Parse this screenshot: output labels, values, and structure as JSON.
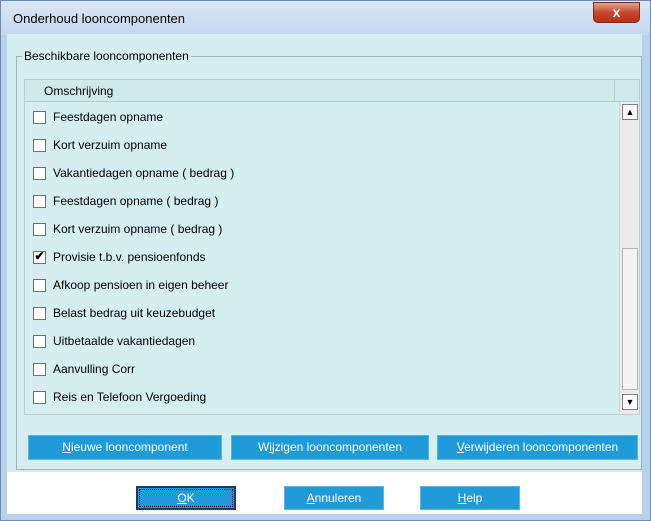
{
  "window": {
    "title": "Onderhoud looncomponenten",
    "close_glyph": "x"
  },
  "group": {
    "label": "Beschikbare looncomponenten"
  },
  "list": {
    "column_header": "Omschrijving",
    "rows": [
      {
        "label": "Feestdagen opname",
        "checked": false
      },
      {
        "label": "Kort verzuim opname",
        "checked": false
      },
      {
        "label": "Vakantiedagen opname ( bedrag )",
        "checked": false
      },
      {
        "label": "Feestdagen opname ( bedrag )",
        "checked": false
      },
      {
        "label": "Kort verzuim opname ( bedrag )",
        "checked": false
      },
      {
        "label": "Provisie t.b.v. pensioenfonds",
        "checked": true
      },
      {
        "label": "Afkoop pensioen in eigen beheer",
        "checked": false
      },
      {
        "label": "Belast bedrag uit keuzebudget",
        "checked": false
      },
      {
        "label": "Uitbetaalde vakantiedagen",
        "checked": false
      },
      {
        "label": "Aanvulling Corr",
        "checked": false
      },
      {
        "label": "Reis en Telefoon Vergoeding",
        "checked": false
      }
    ],
    "check_glyph": "✔",
    "scroll_up_glyph": "▲",
    "scroll_down_glyph": "▼"
  },
  "actions": {
    "new": {
      "mnemonic": "N",
      "rest": "ieuwe looncomponent"
    },
    "edit": {
      "prefix": "W",
      "mnemonic": "i",
      "rest": "jzigen looncomponenten"
    },
    "delete": {
      "mnemonic": "V",
      "rest": "erwijderen looncomponenten"
    }
  },
  "dialog": {
    "ok": {
      "mnemonic": "O",
      "rest": "K"
    },
    "cancel": {
      "mnemonic": "A",
      "rest": "nnuleren"
    },
    "help": {
      "mnemonic": "H",
      "rest": "elp"
    }
  },
  "colors": {
    "client_bg": "#d4eef1",
    "button_blue": "#1e9bd8",
    "title_bar": "#c3d7ee"
  }
}
